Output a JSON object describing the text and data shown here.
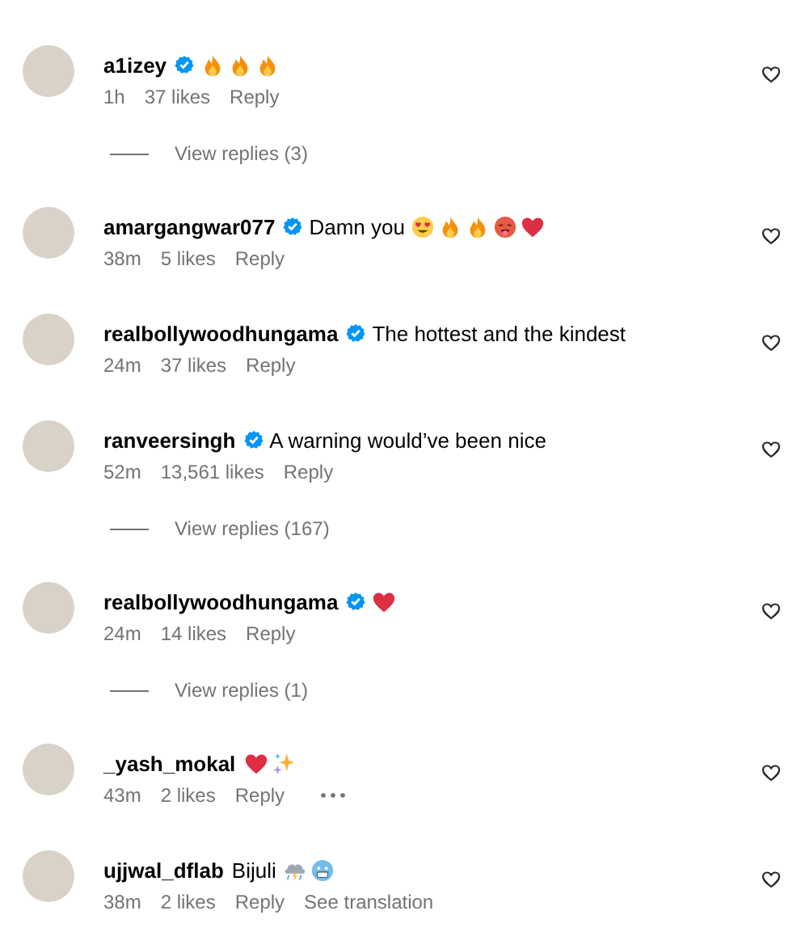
{
  "comments": [
    {
      "username": "a1izey",
      "verified": true,
      "emoji": [
        {
          "kind": "fire"
        },
        {
          "kind": "fire"
        },
        {
          "kind": "fire"
        }
      ],
      "time": "1h",
      "likes": "37 likes",
      "reply": "Reply",
      "view_replies": "View replies (3)"
    },
    {
      "username": "amargangwar077",
      "verified": true,
      "text": "Damn you",
      "emoji": [
        {
          "kind": "heart-eyes"
        },
        {
          "kind": "fire"
        },
        {
          "kind": "fire"
        },
        {
          "kind": "hot-face"
        },
        {
          "kind": "heart"
        }
      ],
      "time": "38m",
      "likes": "5 likes",
      "reply": "Reply"
    },
    {
      "username": "realbollywoodhungama",
      "verified": true,
      "text": "The hottest and the kindest",
      "time": "24m",
      "likes": "37 likes",
      "reply": "Reply"
    },
    {
      "username": "ranveersingh",
      "verified": true,
      "text": "A warning would’ve been nice",
      "time": "52m",
      "likes": "13,561 likes",
      "reply": "Reply",
      "view_replies": "View replies (167)"
    },
    {
      "username": "realbollywoodhungama",
      "verified": true,
      "emoji": [
        {
          "kind": "heart"
        }
      ],
      "time": "24m",
      "likes": "14 likes",
      "reply": "Reply",
      "view_replies": "View replies (1)"
    },
    {
      "username": "_yash_mokal",
      "verified": false,
      "emoji": [
        {
          "kind": "heart"
        },
        {
          "kind": "sparkles"
        }
      ],
      "time": "43m",
      "likes": "2 likes",
      "reply": "Reply",
      "more": true
    },
    {
      "username": "ujjwal_dflab",
      "verified": false,
      "text": "Bijuli",
      "emoji": [
        {
          "kind": "storm-cloud"
        },
        {
          "kind": "cold-face"
        }
      ],
      "time": "38m",
      "likes": "2 likes",
      "reply": "Reply",
      "translation": "See translation"
    }
  ]
}
